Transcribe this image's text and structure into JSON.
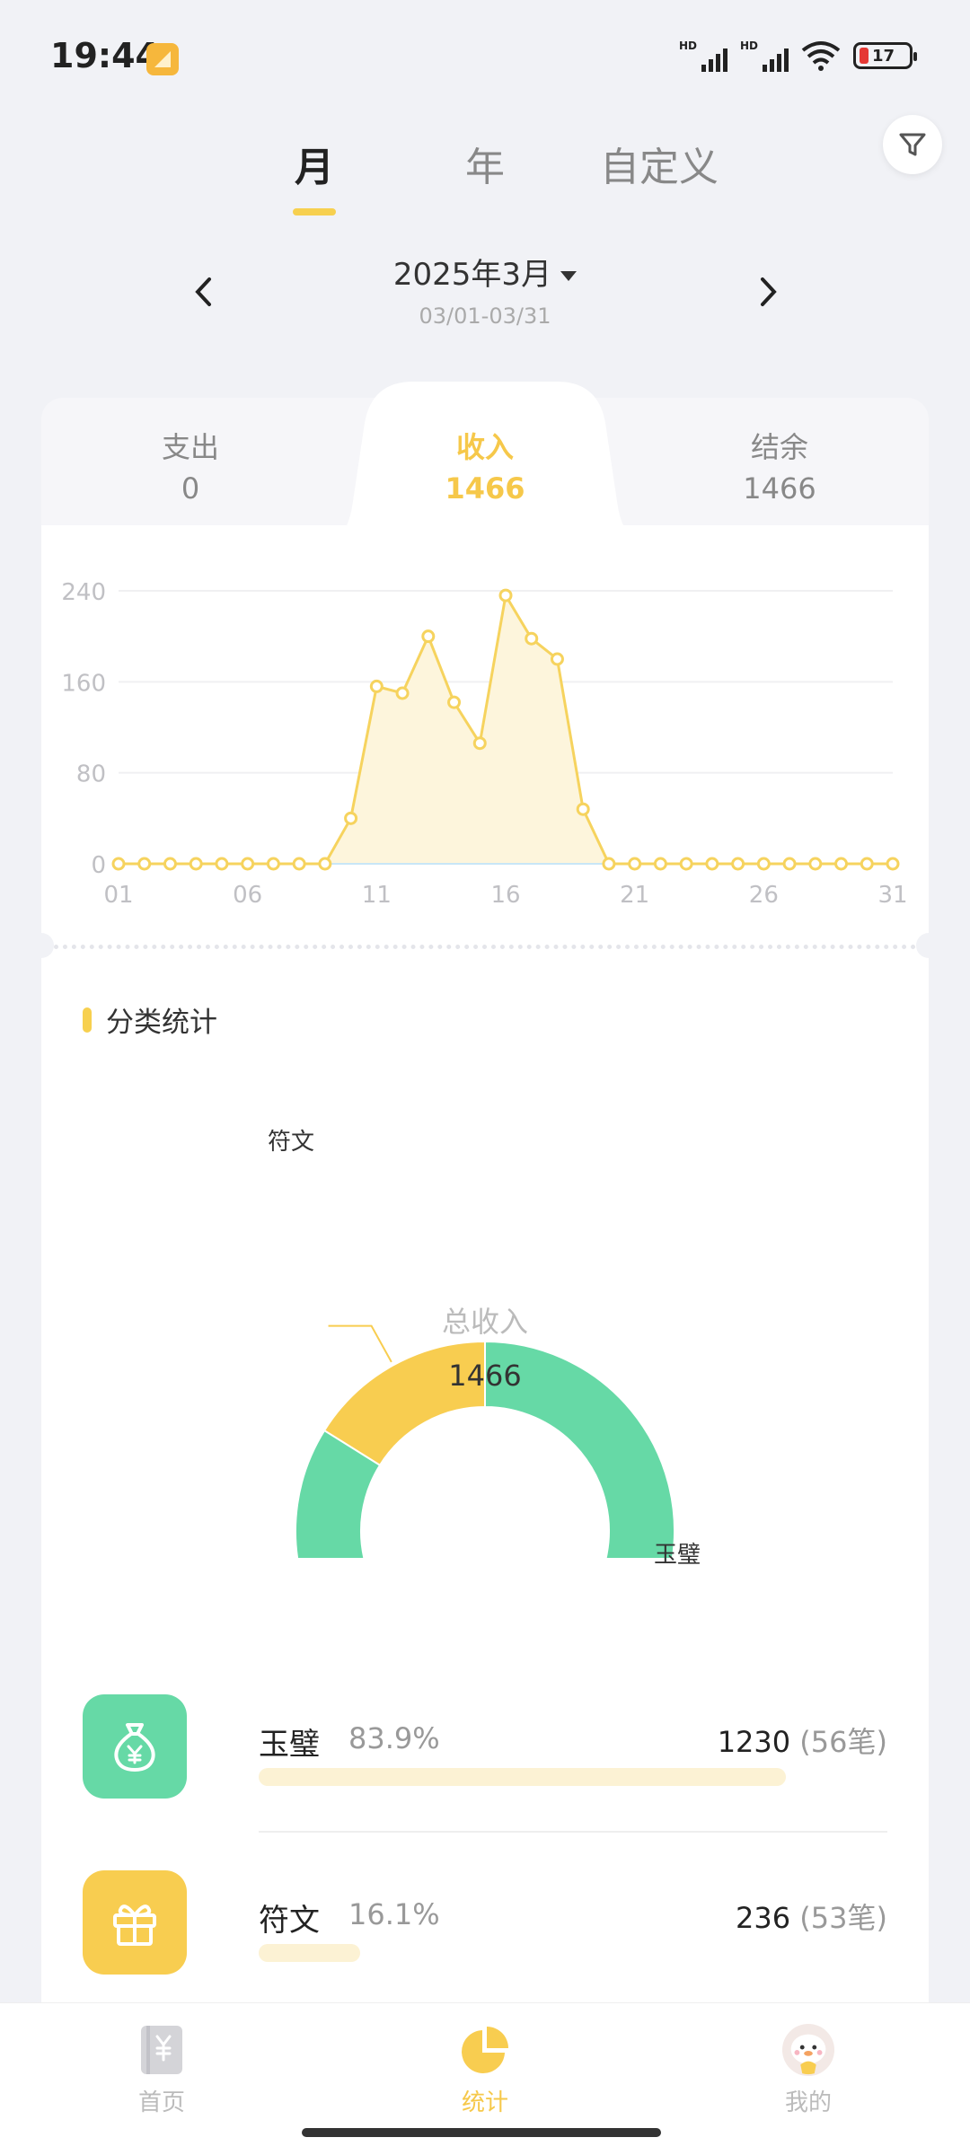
{
  "status_bar": {
    "time": "19:44",
    "signal1": "HD",
    "signal2": "HD",
    "battery": "17"
  },
  "period_tabs": [
    "月",
    "年",
    "自定义"
  ],
  "date": {
    "label": "2025年3月",
    "range": "03/01-03/31"
  },
  "summary_tabs": [
    {
      "title": "支出",
      "value": "0"
    },
    {
      "title": "收入",
      "value": "1466"
    },
    {
      "title": "结余",
      "value": "1466"
    }
  ],
  "chart_data": {
    "type": "area",
    "x": [
      1,
      2,
      3,
      4,
      5,
      6,
      7,
      8,
      9,
      10,
      11,
      12,
      13,
      14,
      15,
      16,
      17,
      18,
      19,
      20,
      21,
      22,
      23,
      24,
      25,
      26,
      27,
      28,
      29,
      30,
      31
    ],
    "values": [
      0,
      0,
      0,
      0,
      0,
      0,
      0,
      0,
      0,
      40,
      156,
      150,
      200,
      142,
      106,
      236,
      198,
      180,
      48,
      0,
      0,
      0,
      0,
      0,
      0,
      0,
      0,
      0,
      0,
      0,
      0
    ],
    "xticks": [
      "01",
      "06",
      "11",
      "16",
      "21",
      "26",
      "31"
    ],
    "yticks": [
      "0",
      "80",
      "160",
      "240"
    ],
    "ylim": [
      0,
      240
    ],
    "color": "#f6d35e",
    "fill": "#fdf5dc",
    "grid": true
  },
  "category": {
    "heading": "分类统计",
    "center_title": "总收入",
    "center_value": "1466",
    "slices": [
      {
        "name": "玉璧",
        "value": 1230,
        "color": "#66d9a6"
      },
      {
        "name": "符文",
        "value": 236,
        "color": "#f8cd50"
      }
    ]
  },
  "items": [
    {
      "name": "玉璧",
      "pct": "83.9%",
      "amount": "1230",
      "count": "(56笔)",
      "fraction": 0.839,
      "icon": "money-bag-icon",
      "color": "#66d9a6"
    },
    {
      "name": "符文",
      "pct": "16.1%",
      "amount": "236",
      "count": "(53笔)",
      "fraction": 0.161,
      "icon": "gift-icon",
      "color": "#f8cd50"
    }
  ],
  "bottom_nav": [
    {
      "label": "首页",
      "icon": "ledger-icon"
    },
    {
      "label": "统计",
      "icon": "pie-chart-icon"
    },
    {
      "label": "我的",
      "icon": "avatar-icon"
    }
  ]
}
